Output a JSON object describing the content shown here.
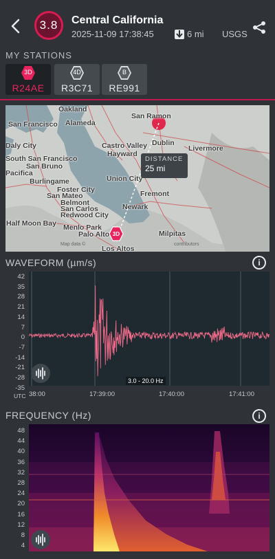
{
  "header": {
    "magnitude": "3.8",
    "title": "Central California",
    "datetime": "2025-11-09 17:38:45",
    "depth": "6 mi",
    "source": "USGS",
    "icons": [
      "back-arrow-icon",
      "down-arrow-icon",
      "share-icon"
    ]
  },
  "stations": {
    "label": "MY STATIONS",
    "items": [
      {
        "badge": "3D",
        "id": "R24AE",
        "active": true,
        "badge_color": "#e8245f"
      },
      {
        "badge": "4D",
        "id": "R3C71",
        "active": false,
        "badge_color": "#c7c9cc"
      },
      {
        "badge": "B",
        "id": "RE991",
        "active": false,
        "badge_color": "#c7c9cc"
      }
    ]
  },
  "map": {
    "places": [
      "Oakland",
      "San Ramon",
      "San Francisco",
      "Alameda",
      "Daly City",
      "Castro Valley",
      "Dublin",
      "Livermore",
      "South San Francisco",
      "Hayward",
      "San Bruno",
      "Pacifica",
      "Union City",
      "Burlingame",
      "Foster City",
      "San Mateo",
      "Fremont",
      "Belmont",
      "San Carlos",
      "Newark",
      "Redwood City",
      "Half Moon Bay",
      "Menlo Park",
      "Palo Alto",
      "Milpitas",
      "Los Altos"
    ],
    "distance_label": "DISTANCE",
    "distance_value": "25 mi",
    "station_badge": "3D",
    "attribution": "Map data ©",
    "attribution_right": "contributors"
  },
  "waveform": {
    "label": "WAVEFORM (µm/s)",
    "y_ticks": [
      "42",
      "35",
      "28",
      "21",
      "14",
      "7",
      "0",
      "-7",
      "-14",
      "-21",
      "-28",
      "-35"
    ],
    "x_prefix": "UTC",
    "x_ticks": [
      "38:00",
      "17:39:00",
      "17:40:00",
      "17:41:00"
    ],
    "filter": "3.0 - 20.0 Hz"
  },
  "frequency": {
    "label": "FREQUENCY (Hz)",
    "y_ticks": [
      "48",
      "44",
      "40",
      "36",
      "32",
      "28",
      "24",
      "20",
      "16",
      "12",
      "8",
      "4"
    ]
  },
  "colors": {
    "accent": "#e8245f",
    "waveform": "#f06b8a",
    "background": "#2f3337"
  }
}
